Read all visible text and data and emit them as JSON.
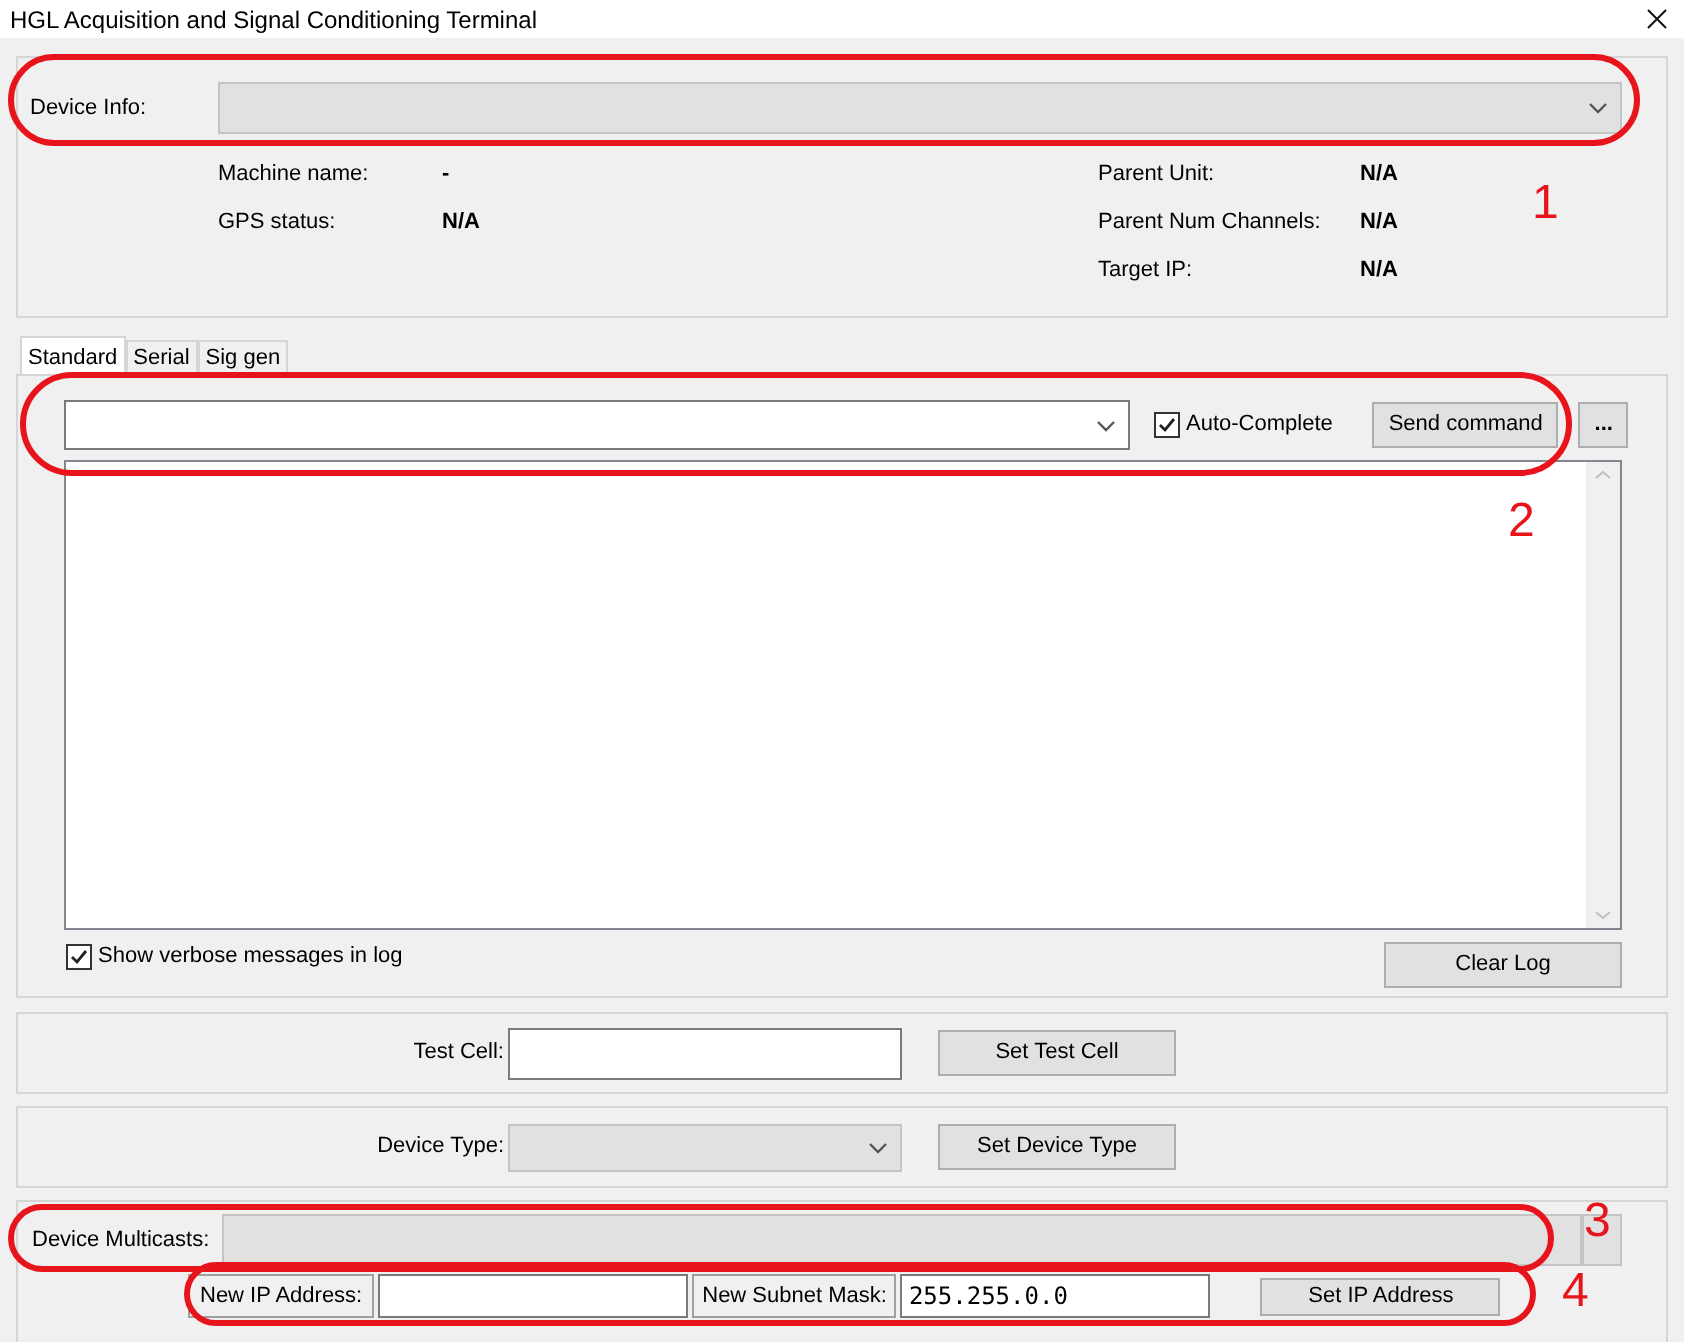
{
  "window": {
    "title": "HGL Acquisition and Signal Conditioning Terminal"
  },
  "device_info": {
    "label": "Device Info:",
    "disabled": true
  },
  "info_rows": [
    {
      "label": "Machine name:",
      "value": "-",
      "right_label": "Parent Unit:",
      "right_value": "N/A"
    },
    {
      "label": "GPS status:",
      "value": "N/A",
      "right_label": "Parent Num Channels:",
      "right_value": "N/A"
    },
    {
      "right_label": "Target IP:",
      "right_value": "N/A"
    }
  ],
  "tabs": [
    {
      "label": "Standard",
      "selected": true
    },
    {
      "label": "Serial",
      "selected": false
    },
    {
      "label": "Sig gen",
      "selected": false
    }
  ],
  "command": {
    "auto_complete": {
      "label": "Auto-Complete",
      "checked": true
    },
    "send_button": "Send command",
    "more_button": "..."
  },
  "verbose": {
    "label": "Show verbose messages in log",
    "checked": true
  },
  "clear_button": "Clear Log",
  "test_cell": {
    "label": "Test Cell:",
    "button": "Set Test Cell"
  },
  "device_type": {
    "label": "Device Type:",
    "disabled": true,
    "button": "Set Device Type"
  },
  "multicasts": {
    "label": "Device Multicasts:",
    "disabled": true
  },
  "ip": {
    "ip_label": "New IP Address:",
    "mask_label": "New Subnet Mask:",
    "mask_value": "255.255.0.0",
    "button": "Set IP Address"
  },
  "annotations": [
    {
      "label": "1"
    },
    {
      "label": "2"
    },
    {
      "label": "3"
    },
    {
      "label": "4"
    }
  ]
}
